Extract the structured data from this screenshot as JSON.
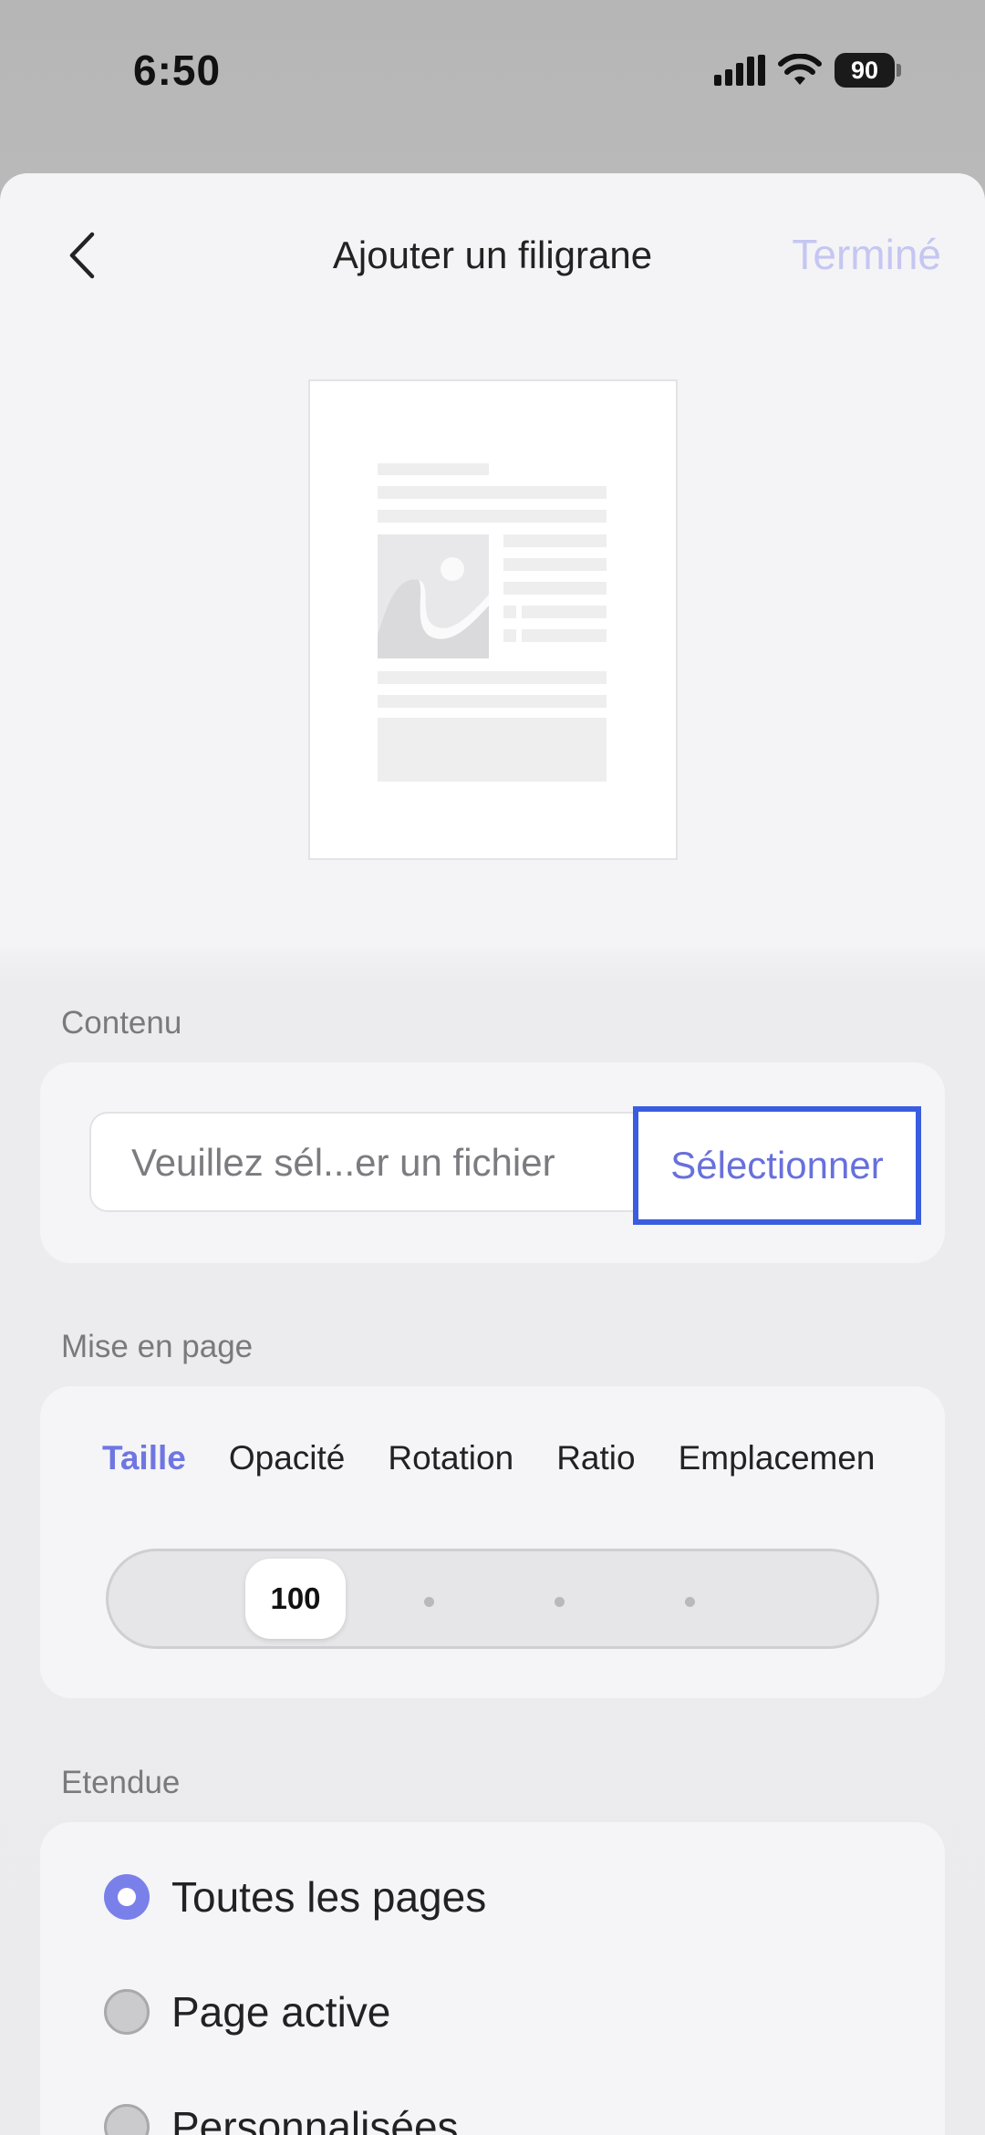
{
  "status_bar": {
    "time": "6:50",
    "battery": "90"
  },
  "header": {
    "title": "Ajouter un filigrane",
    "done_label": "Terminé"
  },
  "content_section": {
    "label": "Contenu",
    "file_placeholder": "Veuillez sél...er un fichier",
    "select_label": "Sélectionner"
  },
  "layout_section": {
    "label": "Mise en page",
    "tabs": [
      "Taille",
      "Opacité",
      "Rotation",
      "Ratio",
      "Emplacemen"
    ],
    "active_tab": "Taille",
    "slider_value": "100"
  },
  "range_section": {
    "label": "Etendue",
    "options": [
      "Toutes les pages",
      "Page active",
      "Personnalisées"
    ],
    "selected": "Toutes les pages"
  },
  "colors": {
    "accent": "#6f76e2",
    "highlight_border": "#3a5de0"
  }
}
